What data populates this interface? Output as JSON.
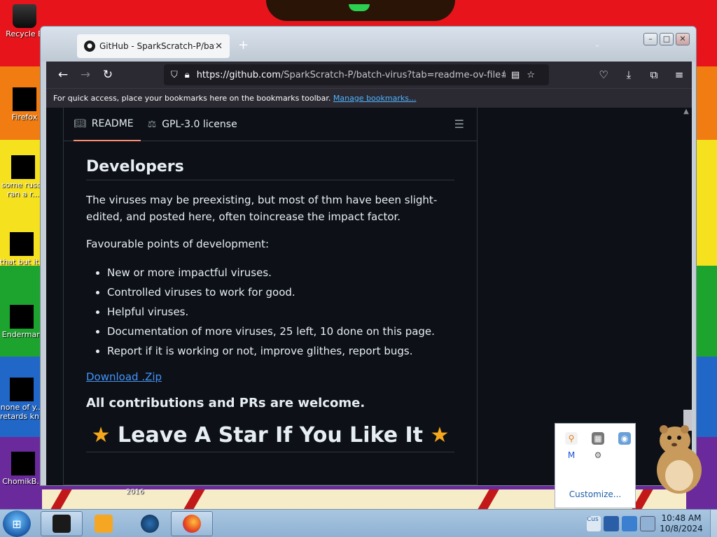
{
  "desktop": {
    "icons": [
      {
        "label": "Recycle B",
        "name": "desktop-icon-recycle-bin"
      },
      {
        "label": "Firefox",
        "name": "desktop-icon-firefox"
      },
      {
        "label": "some russ...",
        "label2": "ran a r...",
        "name": "desktop-icon-some-russ"
      },
      {
        "label": "that but it...",
        "name": "desktop-icon-that-but-it"
      },
      {
        "label": "Enderman",
        "name": "desktop-icon-enderman"
      },
      {
        "label": "none of y...",
        "label2": "retards kn...",
        "name": "desktop-icon-none-of-y"
      },
      {
        "label": "ChomikB...",
        "name": "desktop-icon-chomikb"
      }
    ],
    "wallpaper_text": "2016"
  },
  "browser": {
    "tab_title": "GitHub - SparkScratch-P/batch-virus",
    "new_tab_label": "+",
    "url_host": "https://github.com",
    "url_path": "/SparkScratch-P/batch-virus?tab=readme-ov-file#",
    "bookmarks_text": "For quick access, place your bookmarks here on the bookmarks toolbar.",
    "bookmarks_link": "Manage bookmarks..."
  },
  "readme": {
    "tabs": [
      {
        "label": "README",
        "icon": "book-icon"
      },
      {
        "label": "GPL-3.0 license",
        "icon": "scale-icon"
      }
    ],
    "heading": "Developers",
    "para1": "The viruses may be preexisting, but most of thm have been slight-edited, and posted here, often toincrease the impact factor.",
    "para2": "Favourable points of development:",
    "points": [
      "New or more impactful viruses.",
      "Controlled viruses to work for good.",
      "Helpful viruses.",
      "Documentation of more viruses, 25 left, 10 done on this page.",
      "Report if it is working or not, improve glithes, report bugs."
    ],
    "download_link": "Download .Zip",
    "contrib": "All contributions and PRs are welcome.",
    "star_banner": "Leave A Star If You Like It",
    "star_glyph": "★"
  },
  "tray_flyout": {
    "customize": "Customize..."
  },
  "taskbar": {
    "time": "10:48 AM",
    "date": "10/8/2024",
    "tray_label": "Cus"
  },
  "colors": {
    "github_bg": "#0d1117",
    "link": "#4493f8",
    "firefox_chrome": "#2b2a33",
    "star": "#f6a81c"
  }
}
